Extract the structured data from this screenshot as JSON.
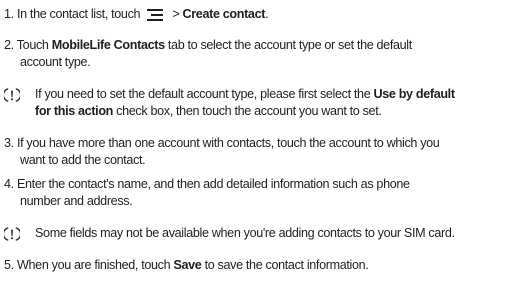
{
  "steps": [
    {
      "num": "1.",
      "t1": "In the contact list, touch",
      "icon": "menu-icon",
      "t2": " > ",
      "b1": "Create contact",
      "t3": "."
    },
    {
      "num": "2.",
      "t1": "Touch ",
      "b1": "MobileLife Contacts",
      "t2": " tab to select the account type or set the default",
      "line2": "account type."
    },
    {
      "num": "3.",
      "t1": "If you have more than one account with contacts, touch the account to which you",
      "line2": "want to add the contact."
    },
    {
      "num": "4.",
      "t1": "Enter the contact's name, and then add detailed information such as phone",
      "line2": "number and address."
    },
    {
      "num": "5.",
      "t1": "When you are finished, touch ",
      "b1": "Save",
      "t2": " to save the contact information."
    }
  ],
  "notes": [
    {
      "icon": "tip-icon",
      "t1": "If you need to set the default account type, please first select the ",
      "b1": "Use by default",
      "b2": "for this action",
      "t2": " check box, then touch the account you want to set."
    },
    {
      "icon": "tip-icon",
      "t1": "Some fields may not be available when you're adding contacts to your SIM card."
    }
  ]
}
